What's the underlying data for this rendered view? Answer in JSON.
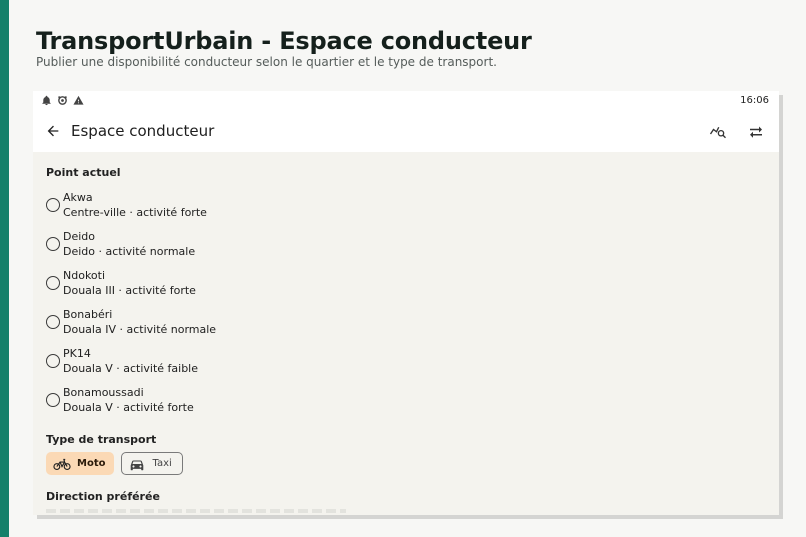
{
  "page": {
    "title": "TransportUrbain - Espace conducteur",
    "subtitle": "Publier une disponibilité conducteur selon le quartier et le type de transport."
  },
  "status_bar": {
    "icons": [
      "notification-bell-icon",
      "android-icon",
      "warning-icon"
    ],
    "time": "16:06"
  },
  "app_bar": {
    "title": "Espace conducteur",
    "actions": [
      "map-search-icon",
      "swap-arrows-icon"
    ]
  },
  "current_point": {
    "label": "Point actuel",
    "options": [
      {
        "name": "Akwa",
        "desc": "Centre-ville · activité forte"
      },
      {
        "name": "Deido",
        "desc": "Deido · activité normale"
      },
      {
        "name": "Ndokoti",
        "desc": "Douala III · activité forte"
      },
      {
        "name": "Bonabéri",
        "desc": "Douala IV · activité normale"
      },
      {
        "name": "PK14",
        "desc": "Douala V · activité faible"
      },
      {
        "name": "Bonamoussadi",
        "desc": "Douala V · activité forte"
      }
    ]
  },
  "transport": {
    "label": "Type de transport",
    "options": [
      {
        "label": "Moto",
        "icon": "bicycle-icon",
        "selected": true
      },
      {
        "label": "Taxi",
        "icon": "car-icon",
        "selected": false
      }
    ]
  },
  "direction": {
    "label": "Direction préférée"
  },
  "colors": {
    "accent": "#15806a",
    "chip_selected": "#fbd9b5",
    "content_bg": "#f4f3ee"
  }
}
